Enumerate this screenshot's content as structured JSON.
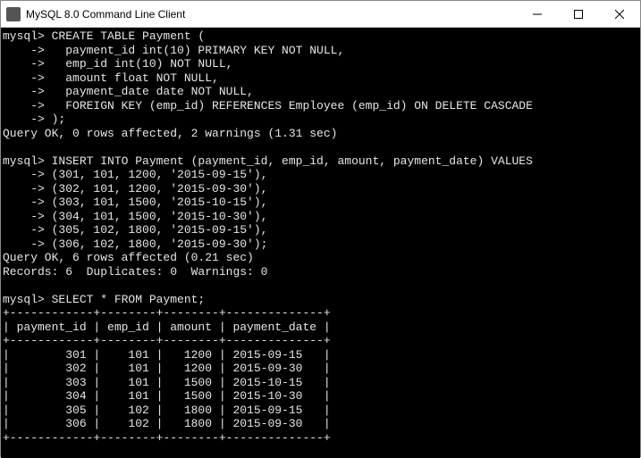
{
  "window": {
    "title": "MySQL 8.0 Command Line Client"
  },
  "terminal": {
    "content": "mysql> CREATE TABLE Payment (\n    ->   payment_id int(10) PRIMARY KEY NOT NULL,\n    ->   emp_id int(10) NOT NULL,\n    ->   amount float NOT NULL,\n    ->   payment_date date NOT NULL,\n    ->   FOREIGN KEY (emp_id) REFERENCES Employee (emp_id) ON DELETE CASCADE\n    -> );\nQuery OK, 0 rows affected, 2 warnings (1.31 sec)\n\nmysql> INSERT INTO Payment (payment_id, emp_id, amount, payment_date) VALUES\n    -> (301, 101, 1200, '2015-09-15'),\n    -> (302, 101, 1200, '2015-09-30'),\n    -> (303, 101, 1500, '2015-10-15'),\n    -> (304, 101, 1500, '2015-10-30'),\n    -> (305, 102, 1800, '2015-09-15'),\n    -> (306, 102, 1800, '2015-09-30');\nQuery OK, 6 rows affected (0.21 sec)\nRecords: 6  Duplicates: 0  Warnings: 0\n\nmysql> SELECT * FROM Payment;\n+------------+--------+--------+--------------+\n| payment_id | emp_id | amount | payment_date |\n+------------+--------+--------+--------------+\n|        301 |    101 |   1200 | 2015-09-15   |\n|        302 |    101 |   1200 | 2015-09-30   |\n|        303 |    101 |   1500 | 2015-10-15   |\n|        304 |    101 |   1500 | 2015-10-30   |\n|        305 |    102 |   1800 | 2015-09-15   |\n|        306 |    102 |   1800 | 2015-09-30   |\n+------------+--------+--------+--------------+"
  }
}
